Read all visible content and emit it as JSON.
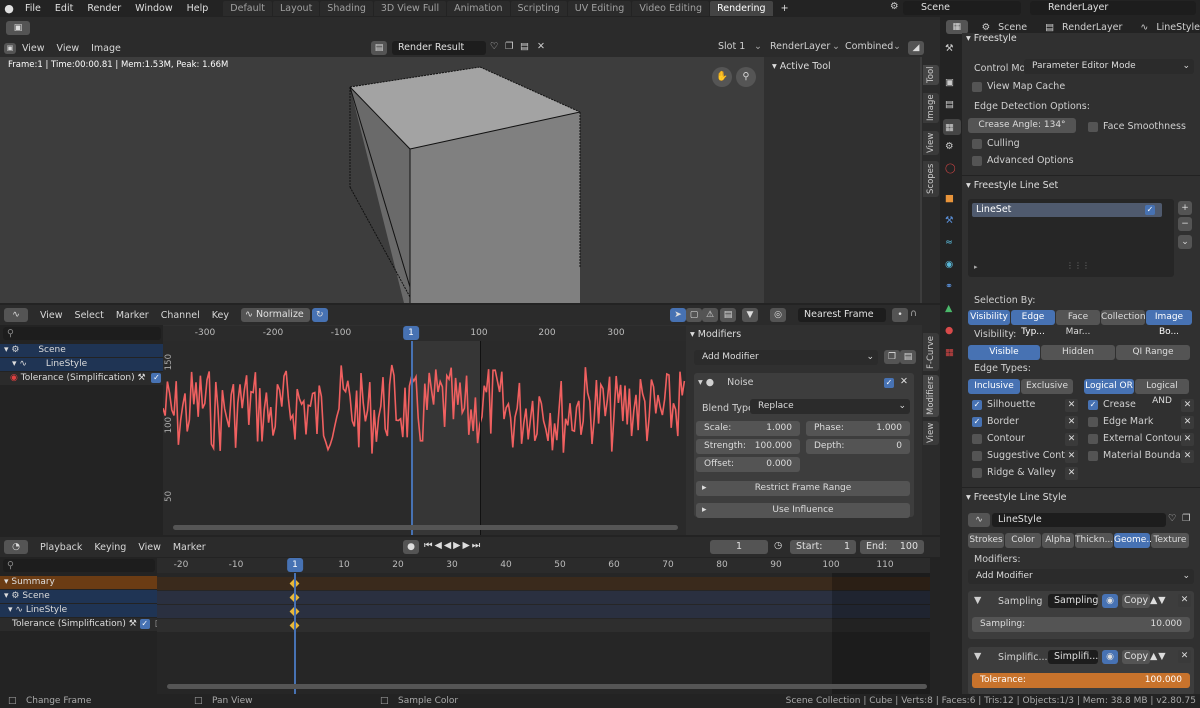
{
  "topbar": {
    "menus": [
      "File",
      "Edit",
      "Render",
      "Window",
      "Help"
    ],
    "workspaces": [
      "Default",
      "Layout",
      "Shading",
      "3D View Full",
      "Animation",
      "Scripting",
      "UV Editing",
      "Video Editing",
      "Rendering"
    ],
    "active_workspace": "Rendering",
    "add": "+",
    "scene": "Scene",
    "view_layer": "RenderLayer"
  },
  "image_editor": {
    "menus": [
      "View",
      "View",
      "Image"
    ],
    "image_name": "Render Result",
    "slot": "Slot 1",
    "layer": "RenderLayer",
    "pass": "Combined",
    "info": "Frame:1 | Time:00:00.81 | Mem:1.53M, Peak: 1.66M",
    "active_tool": "Active Tool",
    "tabs": [
      "Tool",
      "Image",
      "View",
      "Scopes"
    ]
  },
  "graph_editor": {
    "menus": [
      "View",
      "Select",
      "Marker",
      "Channel",
      "Key"
    ],
    "normalize": "Normalize",
    "snap": "Nearest Frame",
    "ticks": [
      "-300",
      "-200",
      "-100",
      "1",
      "100",
      "200",
      "300"
    ],
    "yticks": [
      "150",
      "100",
      "50"
    ],
    "channels": [
      "Scene",
      "LineStyle",
      "Tolerance (Simplification)"
    ],
    "tabs": [
      "F-Curve",
      "Modifiers",
      "View"
    ],
    "modifiers": {
      "title": "Modifiers",
      "add": "Add Modifier",
      "name": "Noise",
      "blend_label": "Blend Type:",
      "blend": "Replace",
      "scale_l": "Scale:",
      "scale": "1.000",
      "phase_l": "Phase:",
      "phase": "1.000",
      "strength_l": "Strength:",
      "strength": "100.000",
      "depth_l": "Depth:",
      "depth": "0",
      "offset_l": "Offset:",
      "offset": "0.000",
      "restrict": "Restrict Frame Range",
      "influence": "Use Influence"
    }
  },
  "timeline": {
    "menus": [
      "Playback",
      "Keying",
      "View",
      "Marker"
    ],
    "frame": "1",
    "start_l": "Start:",
    "start": "1",
    "end_l": "End:",
    "end": "100",
    "ticks": [
      "-20",
      "-10",
      "1",
      "10",
      "20",
      "30",
      "40",
      "50",
      "60",
      "70",
      "80",
      "90",
      "100",
      "110"
    ],
    "rows": [
      "Summary",
      "Scene",
      "LineStyle",
      "Tolerance (Simplification)"
    ]
  },
  "properties": {
    "breadcrumb": [
      "Scene",
      "RenderLayer",
      "LineStyle"
    ],
    "freestyle": {
      "title": "Freestyle",
      "control_l": "Control Mo...",
      "control": "Parameter Editor Mode",
      "view_map_cache": "View Map Cache",
      "edge_detect": "Edge Detection Options:",
      "crease_l": "Crease Angle:",
      "crease": "134°",
      "face_smooth": "Face Smoothness",
      "culling": "Culling",
      "advanced": "Advanced Options"
    },
    "lineset": {
      "title": "Freestyle Line Set",
      "item": "LineSet",
      "select_by": "Selection By:",
      "sel_tabs": [
        "Visibility",
        "Edge Typ...",
        "Face Mar...",
        "Collection",
        "Image Bo..."
      ],
      "visibility_l": "Visibility:",
      "vis_tabs": [
        "Visible",
        "Hidden",
        "QI Range"
      ],
      "edge_types_l": "Edge Types:",
      "incl": [
        "Inclusive",
        "Exclusive"
      ],
      "logic": [
        "Logical OR",
        "Logical AND"
      ],
      "edges_left": [
        "Silhouette",
        "Border",
        "Contour",
        "Suggestive Cont...",
        "Ridge & Valley"
      ],
      "edges_right": [
        "Crease",
        "Edge Mark",
        "External Contour",
        "Material Bounda..."
      ]
    },
    "linestyle": {
      "title": "Freestyle Line Style",
      "name": "LineStyle",
      "tabs": [
        "Strokes",
        "Color",
        "Alpha",
        "Thickn...",
        "Geome...",
        "Texture"
      ],
      "modifiers_l": "Modifiers:",
      "add": "Add Modifier",
      "sampling": {
        "name": "Sampling",
        "type": "Sampling",
        "copy": "Copy",
        "field_l": "Sampling:",
        "value": "10.000"
      },
      "simplify": {
        "name": "Simplific...",
        "type": "Simplifi...",
        "copy": "Copy",
        "field_l": "Tolerance:",
        "value": "100.000"
      }
    }
  },
  "status": {
    "left": "Change Frame",
    "mid": "Pan View",
    "right": "Sample Color",
    "stats": "Scene Collection | Cube | Verts:8 | Faces:6 | Tris:12 | Objects:1/3 | Mem: 38.8 MB | v2.80.75"
  },
  "colors": {
    "accent": "#4772b3",
    "curve": "#f06060",
    "orange": "#c8732c"
  }
}
